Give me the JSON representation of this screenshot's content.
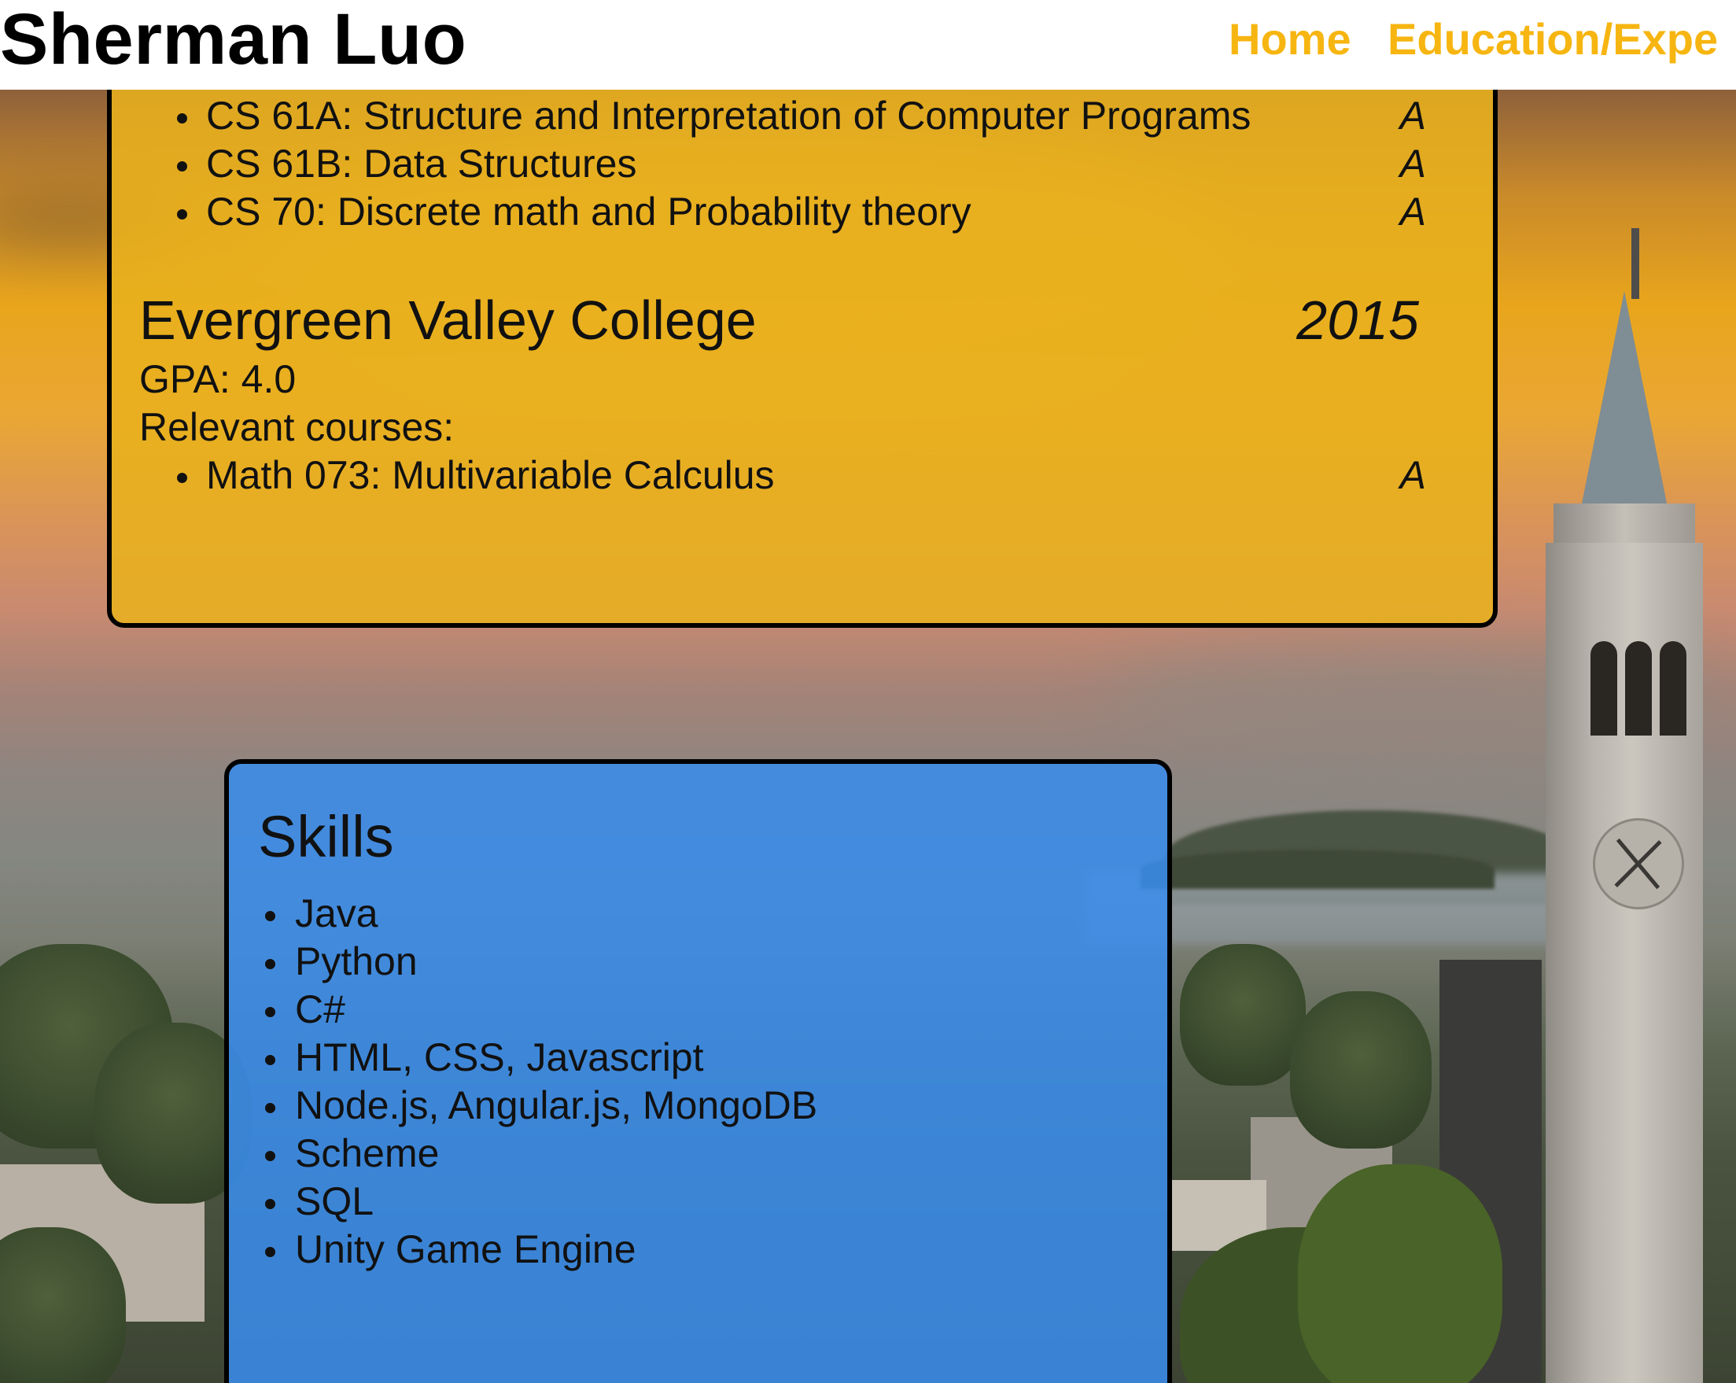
{
  "header": {
    "title": "Sherman Luo",
    "nav": [
      {
        "label": "Home"
      },
      {
        "label": "Education/Expe"
      }
    ],
    "nav_color": "#f6b510"
  },
  "education": {
    "berkeley_courses": [
      {
        "name": "CS 61A: Structure and Interpretation of Computer Programs",
        "grade": "A"
      },
      {
        "name": "CS 61B: Data Structures",
        "grade": "A"
      },
      {
        "name": "CS 70: Discrete math and Probability theory",
        "grade": "A"
      }
    ],
    "evc": {
      "name": "Evergreen Valley College",
      "year": "2015",
      "gpa": "GPA: 4.0",
      "relevant_label": "Relevant courses:",
      "courses": [
        {
          "name": "Math 073: Multivariable Calculus",
          "grade": "A"
        }
      ]
    },
    "panel_color": "#e8b01e"
  },
  "skills": {
    "title": "Skills",
    "items": [
      "Java",
      "Python",
      "C#",
      "HTML, CSS, Javascript",
      "Node.js, Angular.js, MongoDB",
      "Scheme",
      "SQL",
      "Unity Game Engine"
    ],
    "panel_color": "#3a8ceb"
  }
}
